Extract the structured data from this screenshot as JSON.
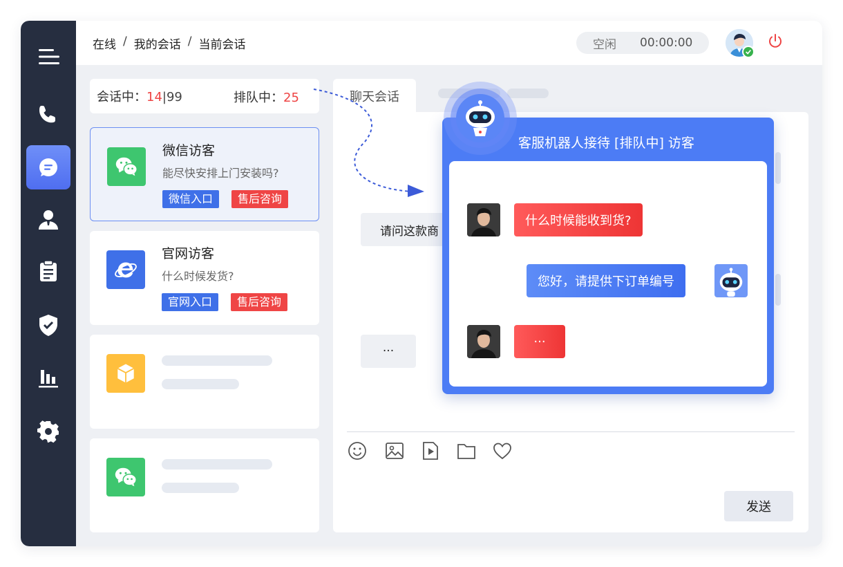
{
  "header": {
    "breadcrumb": [
      "在线",
      "我的会话",
      "当前会话"
    ],
    "breadcrumb_sep": "/",
    "status": "空闲",
    "timer": "00:00:00"
  },
  "sidebar": {
    "items": [
      {
        "icon": "menu-icon"
      },
      {
        "icon": "phone-icon"
      },
      {
        "icon": "chat-icon",
        "active": true
      },
      {
        "icon": "user-icon"
      },
      {
        "icon": "clipboard-icon"
      },
      {
        "icon": "shield-icon"
      },
      {
        "icon": "bar-chart-icon"
      },
      {
        "icon": "gear-icon"
      }
    ]
  },
  "counts": {
    "in_session_label": "会话中：",
    "in_session_value": "14",
    "in_session_sep": "|",
    "in_session_total": "99",
    "queue_label": "排队中：",
    "queue_value": "25"
  },
  "visitors": [
    {
      "title": "微信访客",
      "message": "能尽快安排上门安装吗?",
      "tags": [
        "微信入口",
        "售后咨询"
      ],
      "icon": "wechat-icon",
      "selected": true
    },
    {
      "title": "官网访客",
      "message": "什么时候发货?",
      "tags": [
        "官网入口",
        "售后咨询"
      ],
      "icon": "ie-browser-icon"
    },
    {
      "icon": "box-icon"
    },
    {
      "icon": "wechat-icon"
    }
  ],
  "chat": {
    "tab_label": "聊天会话",
    "partial_message": "请问这款商",
    "ellipsis_message": "···",
    "send_label": "发送",
    "toolbar": [
      "emoji-icon",
      "image-icon",
      "video-icon",
      "folder-icon",
      "heart-icon"
    ]
  },
  "robot_popup": {
    "title": "客服机器人接待 [排队中] 访客",
    "messages": [
      {
        "from": "visitor",
        "text": "什么时候能收到货?"
      },
      {
        "from": "bot",
        "text": "您好，请提供下订单编号"
      },
      {
        "from": "visitor",
        "text": "···"
      }
    ]
  },
  "colors": {
    "accent": "#4c7cf5",
    "sidebar": "#262e40",
    "alert": "#ee4444",
    "wechat": "#3ec66f",
    "ie": "#3f70e8",
    "box": "#ffbf3d"
  }
}
